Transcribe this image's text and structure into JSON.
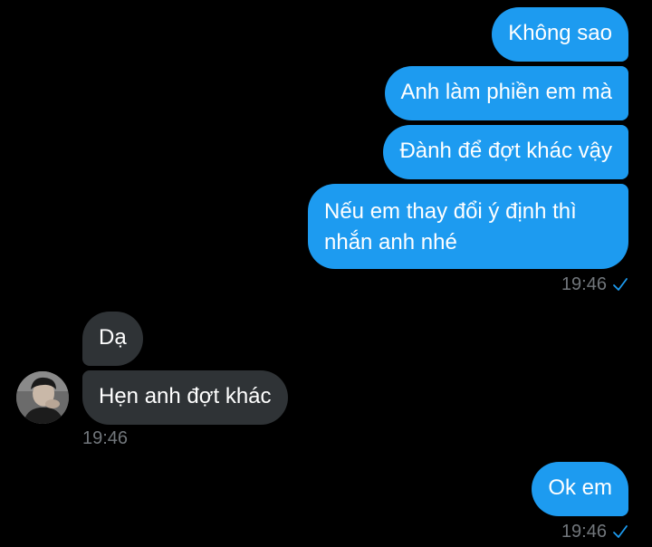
{
  "colors": {
    "outgoing_bubble": "#1d9bf0",
    "incoming_bubble": "#2f3336",
    "timestamp": "#71767b",
    "read_check": "#1d9bf0",
    "background": "#000000"
  },
  "conversation": {
    "outgoing_group_1": [
      {
        "text": "Không sao"
      },
      {
        "text": "Anh làm phiền em mà"
      },
      {
        "text": "Đành để đợt khác vậy"
      },
      {
        "text_line1": "Nếu em thay đổi ý định thì",
        "text_line2": "nhắn anh nhé"
      }
    ],
    "outgoing_group_1_time": "19:46",
    "incoming_group": [
      {
        "text": "Dạ"
      },
      {
        "text": "Hẹn anh đợt khác"
      }
    ],
    "incoming_group_time": "19:46",
    "outgoing_group_2": [
      {
        "text": "Ok em"
      }
    ],
    "outgoing_group_2_time": "19:46"
  },
  "icons": {
    "read_receipt": "check-icon",
    "avatar": "avatar"
  }
}
